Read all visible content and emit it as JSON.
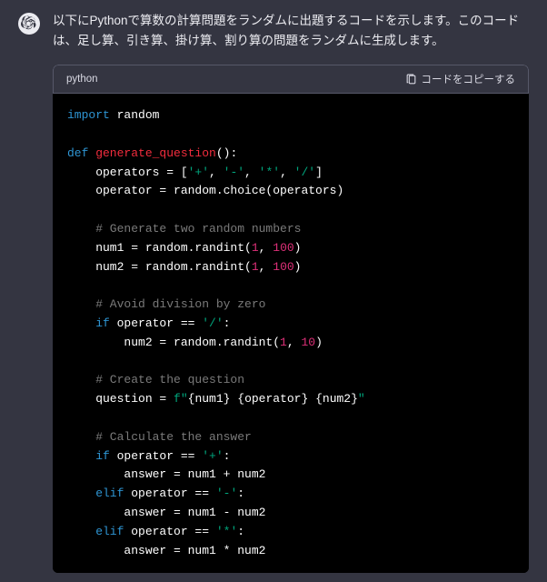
{
  "message": {
    "intro": "以下にPythonで算数の計算問題をランダムに出題するコードを示します。このコードは、足し算、引き算、掛け算、割り算の問題をランダムに生成します。"
  },
  "code_block": {
    "lang_label": "python",
    "copy_label": "コードをコピーする",
    "code": {
      "l1_import": "import",
      "l1_random": " random",
      "l3_def": "def",
      "l3_fn": " generate_question",
      "l3_paren": "():",
      "l4_a": "    operators = [",
      "l4_s1": "'+'",
      "l4_c1": ", ",
      "l4_s2": "'-'",
      "l4_c2": ", ",
      "l4_s3": "'*'",
      "l4_c3": ", ",
      "l4_s4": "'/'",
      "l4_z": "]",
      "l5": "    operator = random.choice(operators)",
      "l7_cmt": "    # Generate two random numbers",
      "l8_a": "    num1 = random.randint(",
      "l8_n1": "1",
      "l8_c": ", ",
      "l8_n2": "100",
      "l8_z": ")",
      "l9_a": "    num2 = random.randint(",
      "l9_n1": "1",
      "l9_c": ", ",
      "l9_n2": "100",
      "l9_z": ")",
      "l11_cmt": "    # Avoid division by zero",
      "l12_if": "    if",
      "l12_b": " operator == ",
      "l12_s": "'/'",
      "l12_z": ":",
      "l13_a": "        num2 = random.randint(",
      "l13_n1": "1",
      "l13_c": ", ",
      "l13_n2": "10",
      "l13_z": ")",
      "l15_cmt": "    # Create the question",
      "l16_a": "    question = ",
      "l16_f": "f\"",
      "l16_i1": "{num1}",
      "l16_sp1": " ",
      "l16_i2": "{operator}",
      "l16_sp2": " ",
      "l16_i3": "{num2}",
      "l16_z": "\"",
      "l18_cmt": "    # Calculate the answer",
      "l19_if": "    if",
      "l19_b": " operator == ",
      "l19_s": "'+'",
      "l19_z": ":",
      "l20": "        answer = num1 + num2",
      "l21_elif": "    elif",
      "l21_b": " operator == ",
      "l21_s": "'-'",
      "l21_z": ":",
      "l22": "        answer = num1 - num2",
      "l23_elif": "    elif",
      "l23_b": " operator == ",
      "l23_s": "'*'",
      "l23_z": ":",
      "l24": "        answer = num1 * num2"
    }
  }
}
